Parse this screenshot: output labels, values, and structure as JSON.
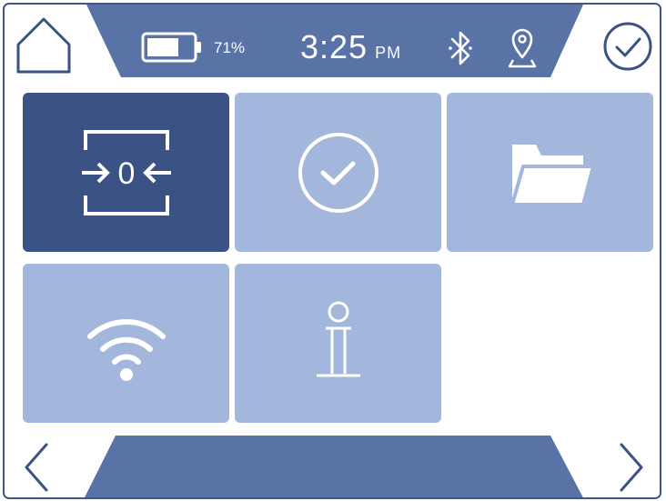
{
  "status": {
    "battery_percent_label": "71%",
    "battery_level": 0.71,
    "time": "3:25",
    "ampm": "PM"
  },
  "icons": {
    "home": "home-icon",
    "battery": "battery-icon",
    "bluetooth": "bluetooth-icon",
    "location": "location-pin-icon",
    "confirm": "checkmark-circle-icon",
    "zero": "zero-calibration-icon",
    "clock": "clock-check-icon",
    "folder": "folder-icon",
    "wifi": "wifi-icon",
    "info": "info-icon",
    "prev": "chevron-left-icon",
    "next": "chevron-right-icon"
  },
  "tiles": [
    {
      "icon": "zero-calibration-icon",
      "selected": true
    },
    {
      "icon": "clock-check-icon",
      "selected": false
    },
    {
      "icon": "folder-icon",
      "selected": false
    },
    {
      "icon": "wifi-icon",
      "selected": false
    },
    {
      "icon": "info-icon",
      "selected": false
    }
  ],
  "zero_label": "0",
  "colors": {
    "dark_blue": "#3a5384",
    "bar_blue": "#5a73a6",
    "tile_light": "#a3b7dc",
    "white": "#ffffff"
  }
}
